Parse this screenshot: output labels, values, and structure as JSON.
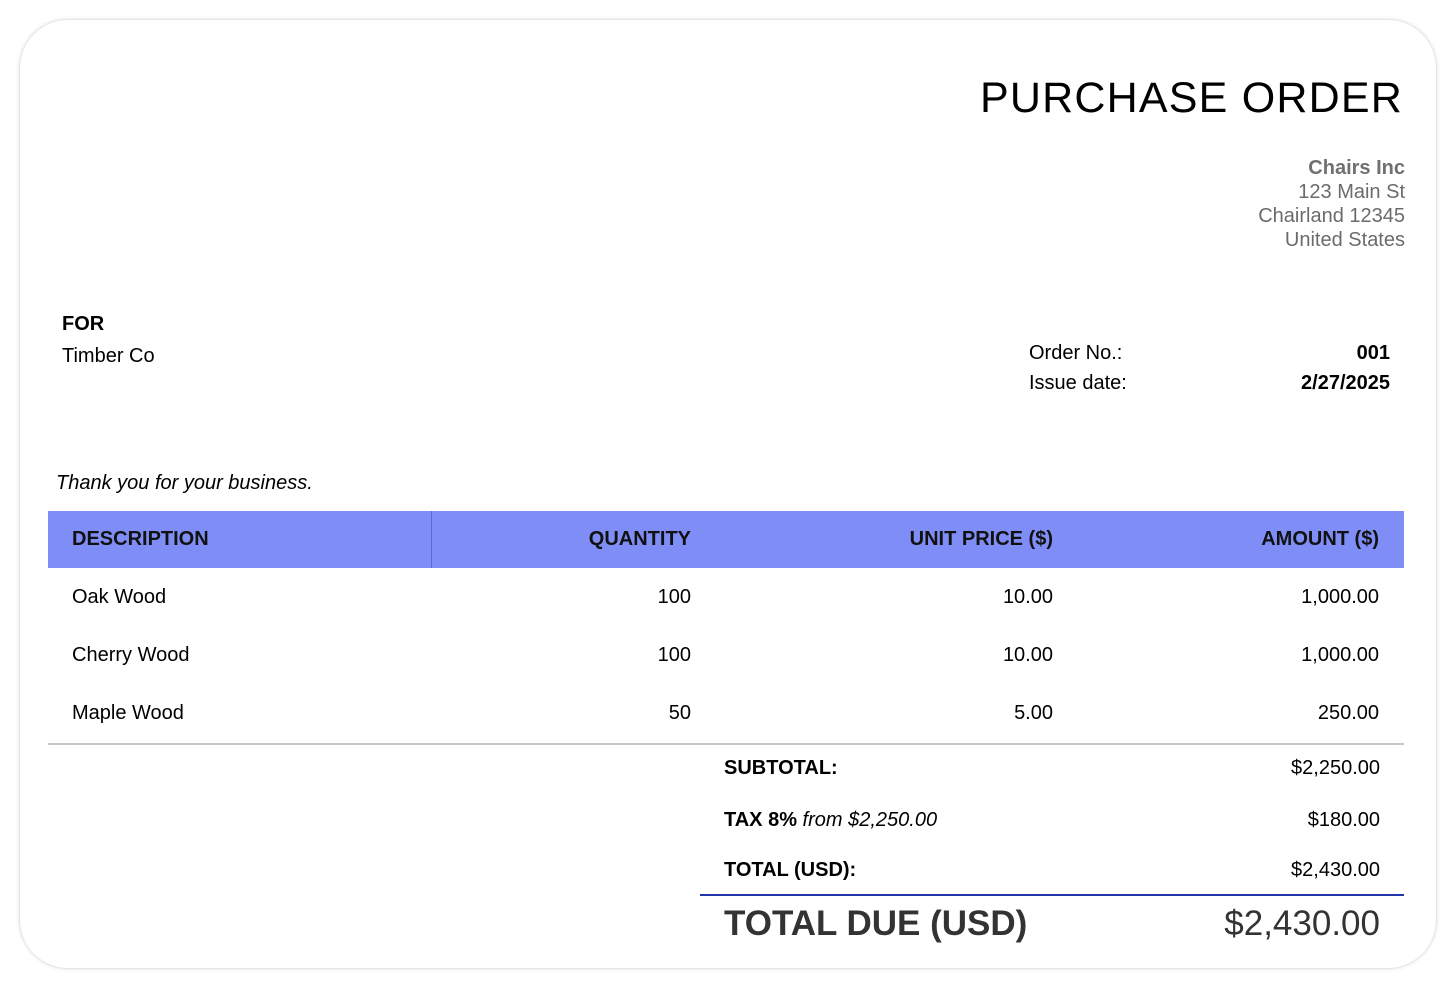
{
  "document": {
    "title": "PURCHASE ORDER"
  },
  "company": {
    "name": "Chairs Inc",
    "address_line1": "123 Main St",
    "address_line2": "Chairland 12345",
    "country": "United States"
  },
  "for_block": {
    "label": "FOR",
    "value": "Timber Co"
  },
  "order_meta": {
    "order_no_label": "Order No.:",
    "order_no_value": "001",
    "issue_date_label": "Issue date:",
    "issue_date_value": "2/27/2025"
  },
  "note": "Thank you for your business.",
  "items_table": {
    "headers": [
      "DESCRIPTION",
      "QUANTITY",
      "UNIT PRICE ($)",
      "AMOUNT ($)"
    ],
    "rows": [
      [
        "Oak Wood",
        "100",
        "10.00",
        "1,000.00"
      ],
      [
        "Cherry Wood",
        "100",
        "10.00",
        "1,000.00"
      ],
      [
        "Maple Wood",
        "50",
        "5.00",
        "250.00"
      ]
    ],
    "header_color": "#7f8ef7"
  },
  "totals": {
    "subtotal_label": "SUBTOTAL:",
    "subtotal_value": "$2,250.00",
    "tax_label": "TAX 8%",
    "tax_from": "from $2,250.00",
    "tax_value": "$180.00",
    "total_label": "TOTAL (USD):",
    "total_value": "$2,430.00",
    "due_label": "TOTAL DUE (USD)",
    "due_value": "$2,430.00",
    "rule_color": "#2435a8"
  }
}
